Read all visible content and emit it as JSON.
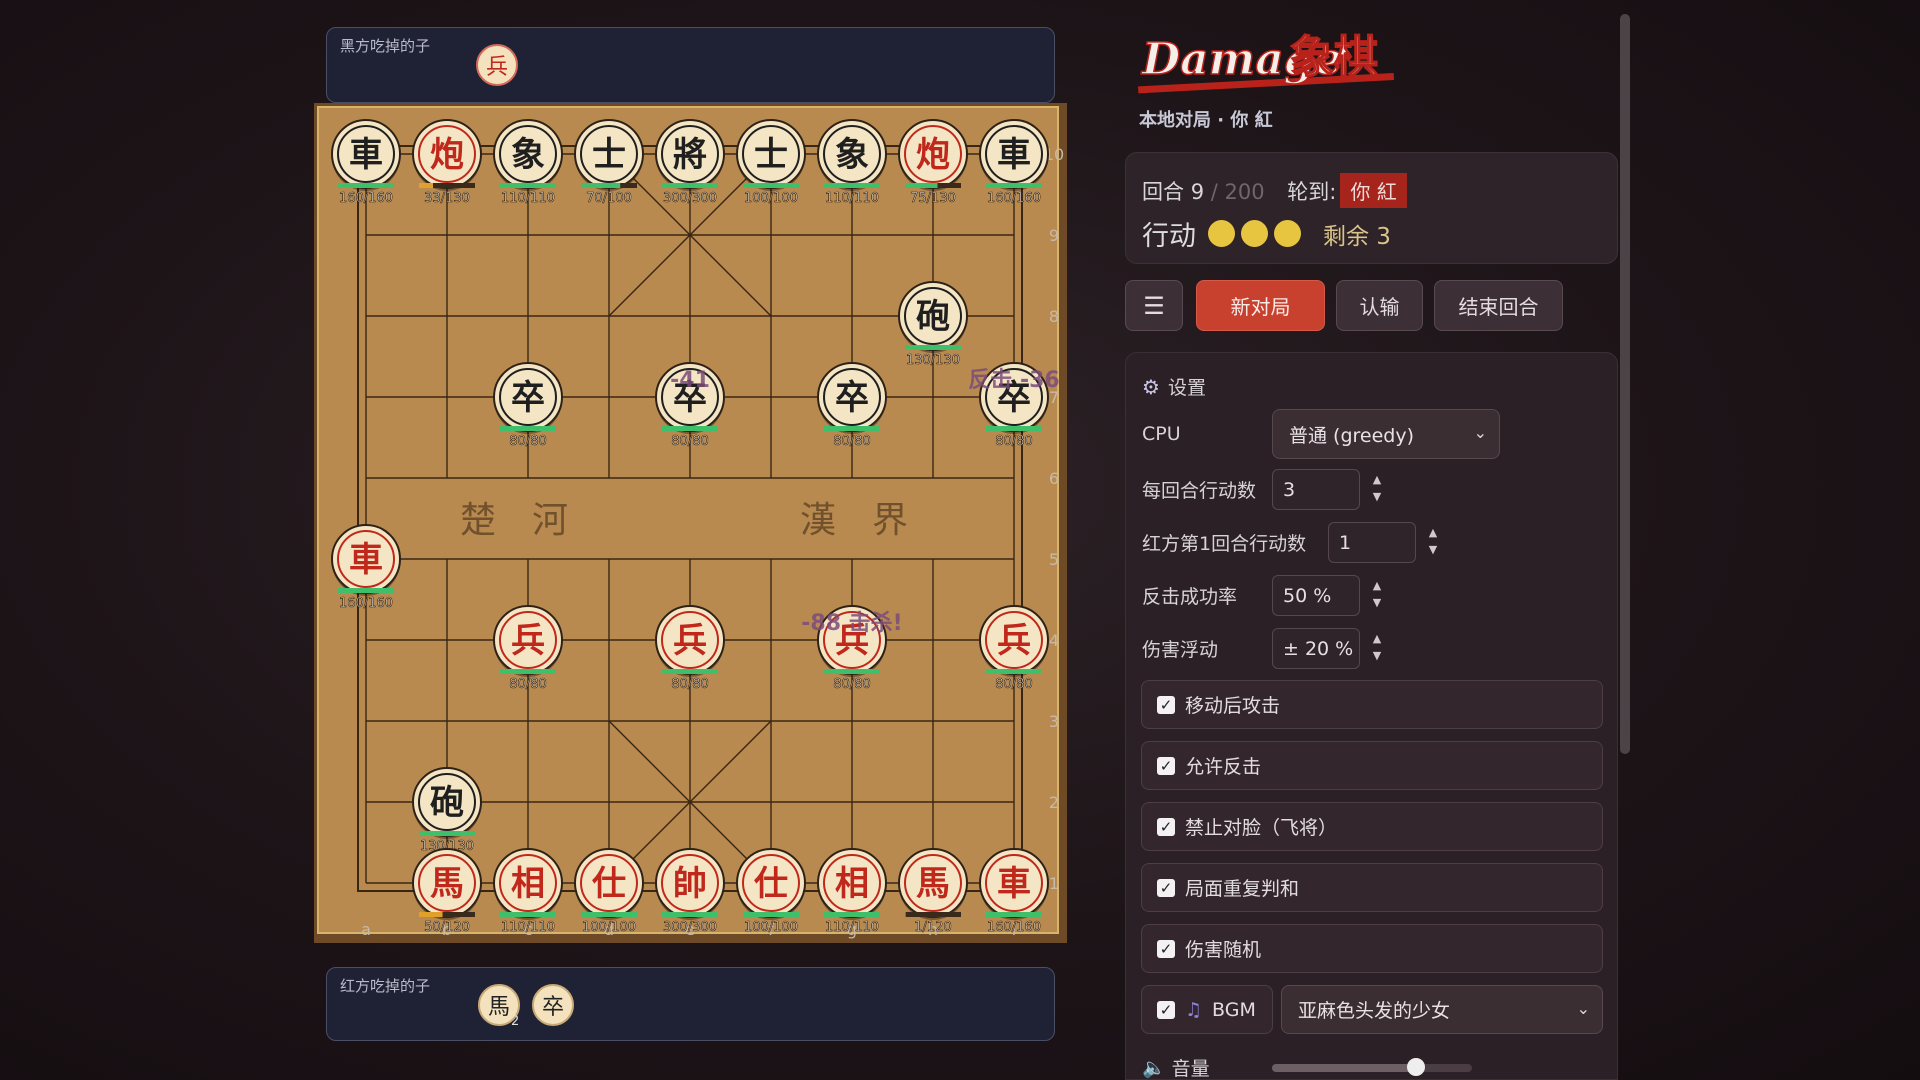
{
  "captured_by_black": {
    "label": "黑方吃掉的子",
    "pieces": [
      {
        "char": "兵",
        "side": "red",
        "count": ""
      }
    ]
  },
  "captured_by_red": {
    "label": "红方吃掉的子",
    "pieces": [
      {
        "char": "馬",
        "side": "black",
        "count": "2"
      },
      {
        "char": "卒",
        "side": "black",
        "count": ""
      }
    ]
  },
  "board": {
    "files": [
      "a",
      "b",
      "c",
      "d",
      "e",
      "f",
      "g",
      "h",
      "i"
    ],
    "ranks": [
      "10",
      "9",
      "8",
      "7",
      "6",
      "5",
      "4",
      "3",
      "2",
      "1"
    ],
    "river_left": "楚　河",
    "river_right": "漢　界",
    "colors": {
      "wood": "#b98a4f",
      "red": "#c0281c",
      "black": "#1f1f1f",
      "hp": "#3fbf6a",
      "hp_low": "#e0a02a"
    },
    "pieces": [
      {
        "file": "a",
        "rank": 10,
        "char": "車",
        "side": "black",
        "hp": "160/160",
        "hp_ratio": 1
      },
      {
        "file": "b",
        "rank": 10,
        "char": "炮",
        "side": "red",
        "hp": "33/130",
        "hp_ratio": 0.25
      },
      {
        "file": "c",
        "rank": 10,
        "char": "象",
        "side": "black",
        "hp": "110/110",
        "hp_ratio": 1
      },
      {
        "file": "d",
        "rank": 10,
        "char": "士",
        "side": "black",
        "hp": "70/100",
        "hp_ratio": 0.7
      },
      {
        "file": "e",
        "rank": 10,
        "char": "將",
        "side": "black",
        "hp": "300/300",
        "hp_ratio": 1
      },
      {
        "file": "f",
        "rank": 10,
        "char": "士",
        "side": "black",
        "hp": "100/100",
        "hp_ratio": 1
      },
      {
        "file": "g",
        "rank": 10,
        "char": "象",
        "side": "black",
        "hp": "110/110",
        "hp_ratio": 1
      },
      {
        "file": "h",
        "rank": 10,
        "char": "炮",
        "side": "red",
        "hp": "75/130",
        "hp_ratio": 0.58
      },
      {
        "file": "i",
        "rank": 10,
        "char": "車",
        "side": "black",
        "hp": "160/160",
        "hp_ratio": 1
      },
      {
        "file": "h",
        "rank": 8,
        "char": "砲",
        "side": "black",
        "hp": "130/130",
        "hp_ratio": 1
      },
      {
        "file": "c",
        "rank": 7,
        "char": "卒",
        "side": "black",
        "hp": "80/80",
        "hp_ratio": 1
      },
      {
        "file": "e",
        "rank": 7,
        "char": "卒",
        "side": "black",
        "hp": "80/80",
        "hp_ratio": 1
      },
      {
        "file": "g",
        "rank": 7,
        "char": "卒",
        "side": "black",
        "hp": "80/80",
        "hp_ratio": 1
      },
      {
        "file": "i",
        "rank": 7,
        "char": "卒",
        "side": "black",
        "hp": "80/80",
        "hp_ratio": 1
      },
      {
        "file": "a",
        "rank": 5,
        "char": "車",
        "side": "red",
        "hp": "160/160",
        "hp_ratio": 1
      },
      {
        "file": "c",
        "rank": 4,
        "char": "兵",
        "side": "red",
        "hp": "80/80",
        "hp_ratio": 1
      },
      {
        "file": "e",
        "rank": 4,
        "char": "兵",
        "side": "red",
        "hp": "80/80",
        "hp_ratio": 1
      },
      {
        "file": "g",
        "rank": 4,
        "char": "兵",
        "side": "red",
        "hp": "80/80",
        "hp_ratio": 1
      },
      {
        "file": "i",
        "rank": 4,
        "char": "兵",
        "side": "red",
        "hp": "80/80",
        "hp_ratio": 1
      },
      {
        "file": "b",
        "rank": 2,
        "char": "砲",
        "side": "black",
        "hp": "130/130",
        "hp_ratio": 1
      },
      {
        "file": "b",
        "rank": 1,
        "char": "馬",
        "side": "red",
        "hp": "50/120",
        "hp_ratio": 0.42
      },
      {
        "file": "c",
        "rank": 1,
        "char": "相",
        "side": "red",
        "hp": "110/110",
        "hp_ratio": 1
      },
      {
        "file": "d",
        "rank": 1,
        "char": "仕",
        "side": "red",
        "hp": "100/100",
        "hp_ratio": 1
      },
      {
        "file": "e",
        "rank": 1,
        "char": "帥",
        "side": "red",
        "hp": "300/300",
        "hp_ratio": 1
      },
      {
        "file": "f",
        "rank": 1,
        "char": "仕",
        "side": "red",
        "hp": "100/100",
        "hp_ratio": 1
      },
      {
        "file": "g",
        "rank": 1,
        "char": "相",
        "side": "red",
        "hp": "110/110",
        "hp_ratio": 1
      },
      {
        "file": "h",
        "rank": 1,
        "char": "馬",
        "side": "red",
        "hp": "1/120",
        "hp_ratio": 0.01
      },
      {
        "file": "i",
        "rank": 1,
        "char": "車",
        "side": "red",
        "hp": "160/160",
        "hp_ratio": 1
      }
    ],
    "floaters": [
      {
        "file": "e",
        "rank": 7,
        "text": "-41"
      },
      {
        "file": "i",
        "rank": 7,
        "text": "反击 -36"
      },
      {
        "file": "g",
        "rank": 4,
        "text": "-88 击杀!"
      }
    ]
  },
  "logo": {
    "text_latin": "Damage",
    "text_cjk": "象棋"
  },
  "subtitle": "本地对局 · 你 紅",
  "status": {
    "round_label": "回合",
    "round": "9",
    "round_max": "/ 200",
    "turn_label": "轮到:",
    "turn_value": "你 紅",
    "action_label": "行动",
    "action_dots": 3,
    "remaining": "剩余 3"
  },
  "buttons": {
    "menu": "☰",
    "new_game": "新对局",
    "resign": "认输",
    "end_turn": "结束回合"
  },
  "settings": {
    "title": "设置",
    "cpu_label": "CPU",
    "cpu_value": "普通 (greedy)",
    "actions_label": "每回合行动数",
    "actions_value": "3",
    "red_first_label": "红方第1回合行动数",
    "red_first_value": "1",
    "counter_label": "反击成功率",
    "counter_value": "50 %",
    "damage_var_label": "伤害浮动",
    "damage_var_value": "± 20 %",
    "checkboxes": [
      "移动后攻击",
      "允许反击",
      "禁止对脸（飞将）",
      "局面重复判和",
      "伤害随机"
    ],
    "bgm_label": "BGM",
    "bgm_value": "亚麻色头发的少女",
    "volume_label": "音量",
    "volume": 0.72
  }
}
